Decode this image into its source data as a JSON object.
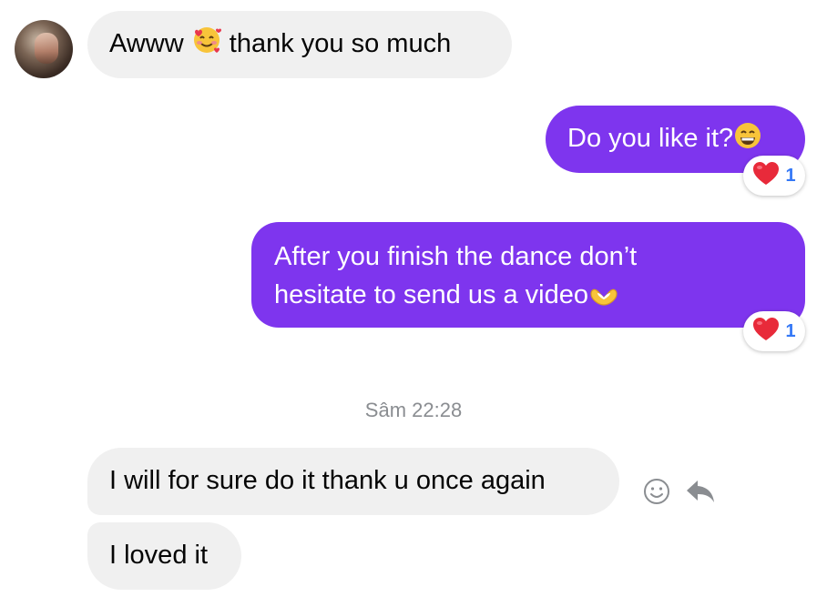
{
  "messages": [
    {
      "text_before": "Awww",
      "emoji": "smiling-face-with-hearts",
      "text_after": "thank you so much"
    },
    {
      "text": "Do you like it?",
      "emoji": "grinning-face-with-smiling-eyes",
      "reaction": {
        "icon": "heart",
        "count": "1"
      }
    },
    {
      "line1": "After you finish the dance don’t",
      "line2": "hesitate to send us a video",
      "emoji": "heart-hands",
      "reaction": {
        "icon": "heart",
        "count": "1"
      }
    },
    {
      "text": "I will for sure do it thank u once again"
    },
    {
      "text": "I loved it"
    }
  ],
  "timestamp": "Sâm 22:28",
  "colors": {
    "outgoing": "#7e35ee",
    "incoming": "#f0f0f0",
    "reaction_count": "#3478f6"
  },
  "actions": [
    "emoji-react-icon",
    "reply-icon"
  ]
}
